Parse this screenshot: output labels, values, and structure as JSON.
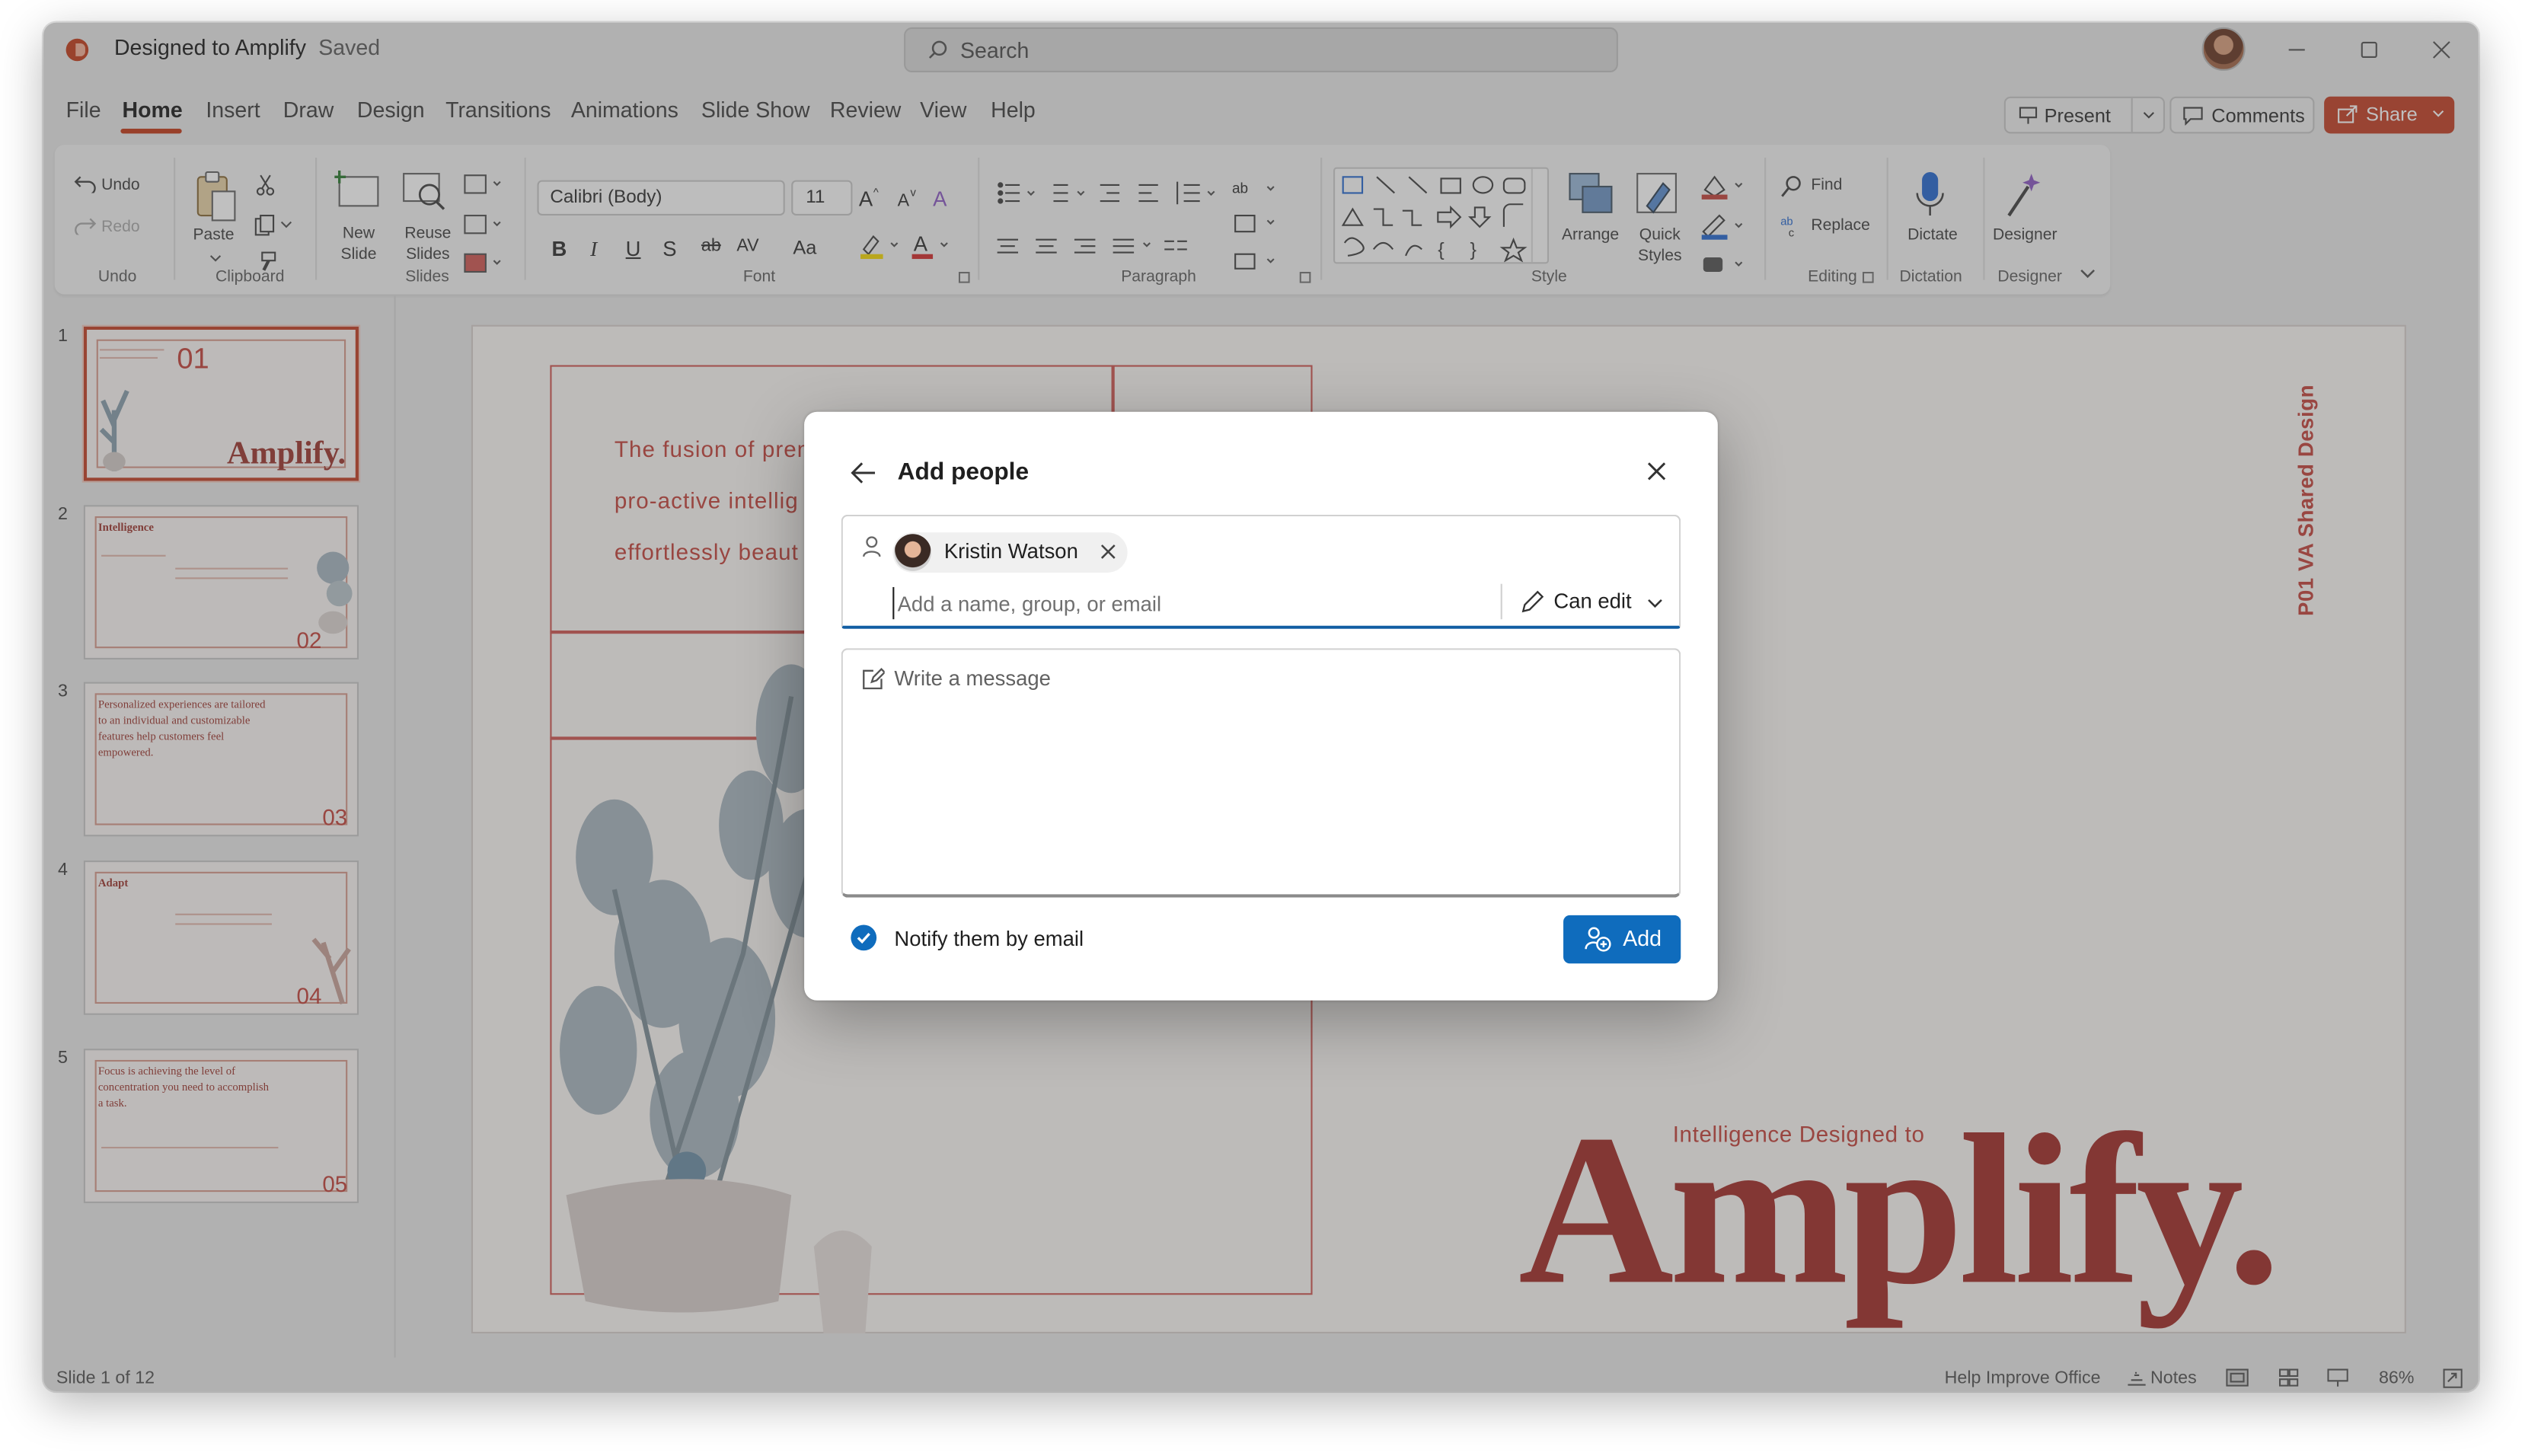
{
  "window": {
    "doc_title": "Designed to Amplify",
    "saved_status": "Saved",
    "search_placeholder": "Search"
  },
  "menu": {
    "items": [
      "File",
      "Home",
      "Insert",
      "Draw",
      "Design",
      "Transitions",
      "Animations",
      "Slide Show",
      "Review",
      "View",
      "Help"
    ],
    "active": "Home",
    "present_label": "Present",
    "comments_label": "Comments",
    "share_label": "Share"
  },
  "ribbon": {
    "undo_label": "Undo",
    "redo_label": "Redo",
    "paste_label": "Paste",
    "new_slide_label": "New Slide",
    "reuse_slides_label": "Reuse Slides",
    "font_name": "Calibri (Body)",
    "font_size": "11",
    "arrange_label": "Arrange",
    "quick_styles_label": "Quick Styles",
    "find_label": "Find",
    "replace_label": "Replace",
    "dictate_label": "Dictate",
    "designer_label": "Designer",
    "groups": {
      "undo": "Undo",
      "clipboard": "Clipboard",
      "slides": "Slides",
      "font": "Font",
      "paragraph": "Paragraph",
      "style": "Style",
      "editing": "Editing",
      "dictation": "Dictation",
      "designer": "Designer"
    }
  },
  "thumbnails": [
    {
      "num": "1",
      "big": "01",
      "title": "Amplify.",
      "selected": true
    },
    {
      "num": "2",
      "big": "02",
      "title": "Intelligence",
      "selected": false
    },
    {
      "num": "3",
      "big": "03",
      "title": "Personalized experiences are tailored to an individual and customizable features help customers feel empowered.",
      "selected": false
    },
    {
      "num": "4",
      "big": "04",
      "title": "Adapt",
      "selected": false
    },
    {
      "num": "5",
      "big": "05",
      "title": "Focus is achieving the level of concentration you need to accomplish a task.",
      "selected": false
    }
  ],
  "slide": {
    "line1": "The fusion of prem",
    "line2": "pro-active intellig",
    "line3": "effortlessly beaut",
    "vertical_text": "P01   VA Shared Design",
    "subtitle": "Intelligence Designed to",
    "headline": "Amplify."
  },
  "status": {
    "slide_count": "Slide 1 of 12",
    "help": "Help Improve Office",
    "notes": "Notes",
    "zoom": "86%"
  },
  "dialog": {
    "title": "Add people",
    "person_name": "Kristin Watson",
    "add_placeholder": "Add a name, group, or email",
    "permission": "Can edit",
    "message_placeholder": "Write a message",
    "notify_label": "Notify them by email",
    "notify_checked": true,
    "add_button": "Add"
  },
  "colors": {
    "accent": "#c4432a",
    "primary_button": "#0f6cbd",
    "slide_text": "#c4473f",
    "headline": "#a3302b"
  }
}
